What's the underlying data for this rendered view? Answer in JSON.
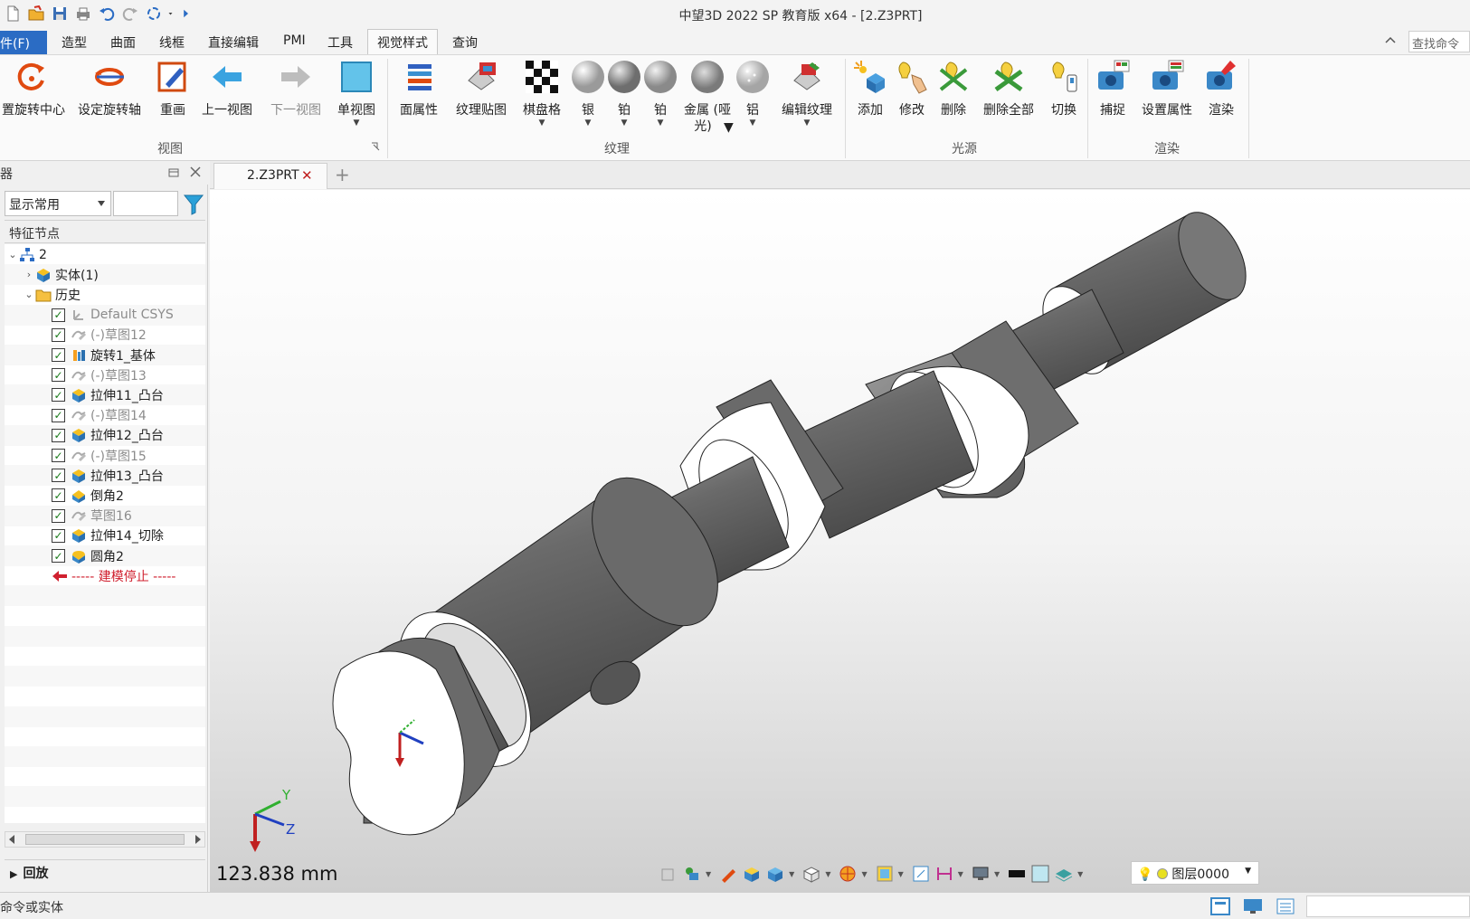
{
  "window": {
    "title": "中望3D 2022 SP 教育版 x64 - [2.Z3PRT]"
  },
  "quick_access": [
    "new-file-icon",
    "open-file-icon",
    "save-icon",
    "print-icon",
    "undo-icon",
    "redo-icon",
    "regen-icon",
    "customize-dropdown-icon",
    "run-icon"
  ],
  "menu": {
    "file": "件(F)",
    "tabs": [
      "造型",
      "曲面",
      "线框",
      "直接编辑",
      "PMI",
      "工具",
      "视觉样式",
      "查询"
    ],
    "active_tab": "视觉样式",
    "search_placeholder": "查找命令"
  },
  "ribbon": {
    "groups": {
      "view": "视图",
      "texture": "纹理",
      "light": "光源",
      "render": "渲染"
    },
    "buttons": {
      "rotate_center": "置旋转中心",
      "rotate_axis": "设定旋转轴",
      "redraw": "重画",
      "prev_view": "上一视图",
      "next_view": "下一视图",
      "single_view": "单视图",
      "face_attr": "面属性",
      "texture_map": "纹理贴图",
      "checker": "棋盘格",
      "silver": "银",
      "platinum": "铂",
      "platinum2": "铂",
      "metal_matte": "金属 (哑",
      "metal_matte2": "光)",
      "aluminum": "铝",
      "edit_texture": "编辑纹理",
      "add_light": "添加",
      "modify_light": "修改",
      "delete_light": "删除",
      "delete_all_light": "删除全部",
      "toggle_light": "切换",
      "capture": "捕捉",
      "set_attr": "设置属性",
      "render": "渲染"
    }
  },
  "left_panel": {
    "title": "器",
    "filter_value": "显示常用",
    "tree_header": "特征节点",
    "tree": [
      {
        "label": "2",
        "level": 0,
        "toggle": "⌄",
        "checked": null,
        "icon": "assembly-icon",
        "style": "normal"
      },
      {
        "label": "实体(1)",
        "level": 1,
        "toggle": "›",
        "checked": null,
        "icon": "solid-icon",
        "style": "normal"
      },
      {
        "label": "历史",
        "level": 1,
        "toggle": "⌄",
        "checked": null,
        "icon": "folder-icon",
        "style": "normal"
      },
      {
        "label": "Default CSYS",
        "level": 2,
        "toggle": "",
        "checked": true,
        "icon": "csys-icon",
        "style": "grey"
      },
      {
        "label": "(-)草图12",
        "level": 2,
        "toggle": "",
        "checked": true,
        "icon": "sketch-icon",
        "style": "grey"
      },
      {
        "label": "旋转1_基体",
        "level": 2,
        "toggle": "",
        "checked": true,
        "icon": "revolve-icon",
        "style": "normal"
      },
      {
        "label": "(-)草图13",
        "level": 2,
        "toggle": "",
        "checked": true,
        "icon": "sketch-icon",
        "style": "grey"
      },
      {
        "label": "拉伸11_凸台",
        "level": 2,
        "toggle": "",
        "checked": true,
        "icon": "extrude-icon",
        "style": "normal"
      },
      {
        "label": "(-)草图14",
        "level": 2,
        "toggle": "",
        "checked": true,
        "icon": "sketch-icon",
        "style": "grey"
      },
      {
        "label": "拉伸12_凸台",
        "level": 2,
        "toggle": "",
        "checked": true,
        "icon": "extrude-icon",
        "style": "normal"
      },
      {
        "label": "(-)草图15",
        "level": 2,
        "toggle": "",
        "checked": true,
        "icon": "sketch-icon",
        "style": "grey"
      },
      {
        "label": "拉伸13_凸台",
        "level": 2,
        "toggle": "",
        "checked": true,
        "icon": "extrude-icon",
        "style": "normal"
      },
      {
        "label": "倒角2",
        "level": 2,
        "toggle": "",
        "checked": true,
        "icon": "chamfer-icon",
        "style": "normal"
      },
      {
        "label": "草图16",
        "level": 2,
        "toggle": "",
        "checked": true,
        "icon": "sketch-icon",
        "style": "grey"
      },
      {
        "label": "拉伸14_切除",
        "level": 2,
        "toggle": "",
        "checked": true,
        "icon": "extrude-icon",
        "style": "normal"
      },
      {
        "label": "圆角2",
        "level": 2,
        "toggle": "",
        "checked": true,
        "icon": "fillet-icon",
        "style": "normal"
      },
      {
        "label": "----- 建模停止 -----",
        "level": 2,
        "toggle": "",
        "checked": null,
        "icon": "stop-arrow-icon",
        "style": "red"
      }
    ],
    "replay": "回放"
  },
  "document": {
    "tab": "2.Z3PRT",
    "measure": "123.838 mm",
    "layer": "图层0000"
  },
  "status": {
    "text": "命令或实体"
  },
  "colors": {
    "accent": "#2b6cc4",
    "model_body": "#6b6b6b",
    "model_face": "#ffffff",
    "stop_marker": "#d0202f"
  }
}
